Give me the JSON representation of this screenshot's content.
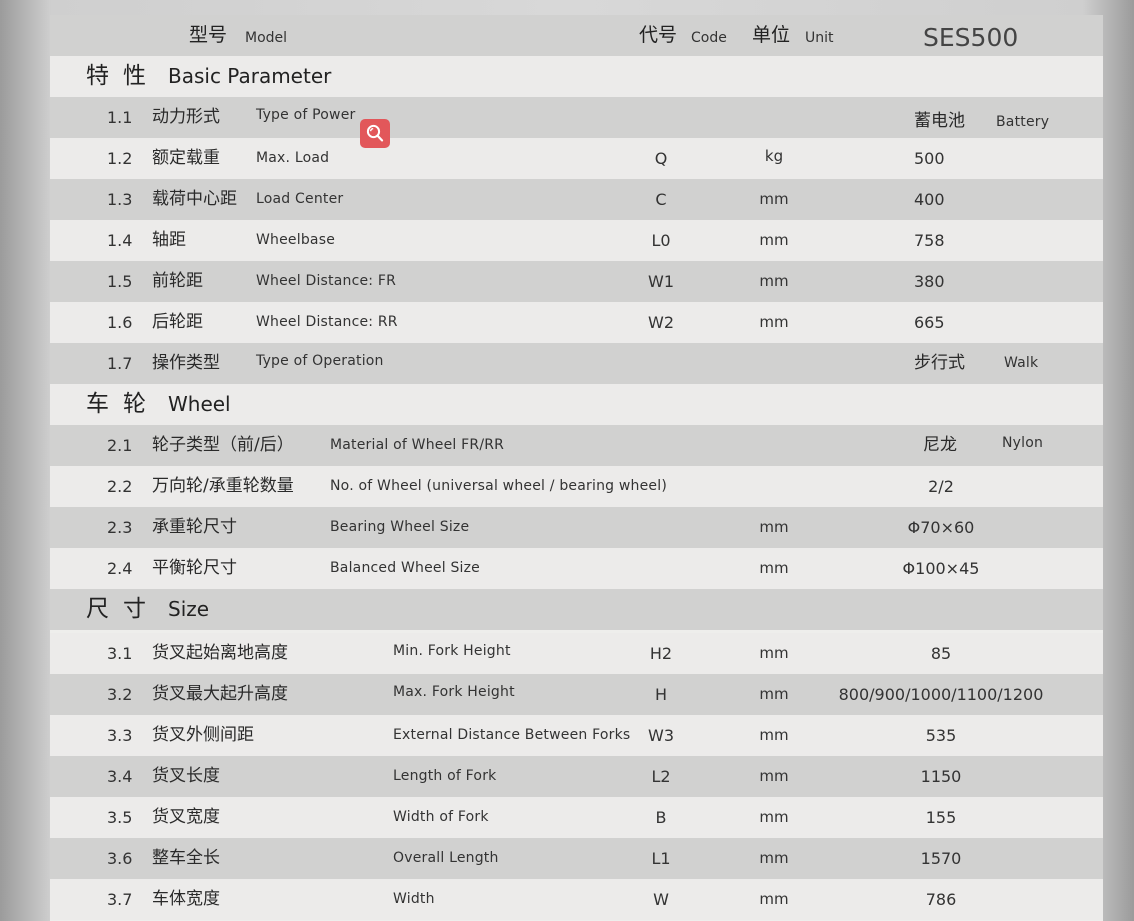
{
  "header": {
    "model_cn": "型号",
    "model_en": "Model",
    "code_cn": "代号",
    "code_en": "Code",
    "unit_cn": "单位",
    "unit_en": "Unit",
    "model_value": "SES500"
  },
  "sections": {
    "basic": {
      "cn": "特性",
      "en": "Basic Parameter"
    },
    "wheel": {
      "cn": "车轮",
      "en": "Wheel"
    },
    "size": {
      "cn": "尺寸",
      "en": "Size"
    }
  },
  "rows": {
    "r1_1": {
      "no": "1.1",
      "cn": "动力形式",
      "en": "Type of Power",
      "code": "",
      "unit": "",
      "value_cn": "蓄电池",
      "value_en": "Battery"
    },
    "r1_2": {
      "no": "1.2",
      "cn": "额定载重",
      "en": "Max. Load",
      "code": "Q",
      "unit": "kg",
      "value": "500"
    },
    "r1_3": {
      "no": "1.3",
      "cn": "载荷中心距",
      "en": "Load Center",
      "code": "C",
      "unit": "mm",
      "value": "400"
    },
    "r1_4": {
      "no": "1.4",
      "cn": "轴距",
      "en": "Wheelbase",
      "code": "L0",
      "unit": "mm",
      "value": "758"
    },
    "r1_5": {
      "no": "1.5",
      "cn": "前轮距",
      "en": "Wheel Distance: FR",
      "code": "W1",
      "unit": "mm",
      "value": "380"
    },
    "r1_6": {
      "no": "1.6",
      "cn": "后轮距",
      "en": "Wheel Distance: RR",
      "code": "W2",
      "unit": "mm",
      "value": "665"
    },
    "r1_7": {
      "no": "1.7",
      "cn": "操作类型",
      "en": "Type of Operation",
      "code": "",
      "unit": "",
      "value_cn": "步行式",
      "value_en": "Walk"
    },
    "r2_1": {
      "no": "2.1",
      "cn": "轮子类型（前/后）",
      "en": "Material of Wheel FR/RR",
      "code": "",
      "unit": "",
      "value_cn": "尼龙",
      "value_en": "Nylon"
    },
    "r2_2": {
      "no": "2.2",
      "cn": "万向轮/承重轮数量",
      "en": "No. of Wheel (universal wheel / bearing wheel)",
      "code": "",
      "unit": "",
      "value": "2/2"
    },
    "r2_3": {
      "no": "2.3",
      "cn": "承重轮尺寸",
      "en": "Bearing Wheel Size",
      "code": "",
      "unit": "mm",
      "value": "Φ70×60"
    },
    "r2_4": {
      "no": "2.4",
      "cn": "平衡轮尺寸",
      "en": "Balanced Wheel Size",
      "code": "",
      "unit": "mm",
      "value": "Φ100×45"
    },
    "r3_1": {
      "no": "3.1",
      "cn": "货叉起始离地高度",
      "en": "Min. Fork Height",
      "code": "H2",
      "unit": "mm",
      "value": "85"
    },
    "r3_2": {
      "no": "3.2",
      "cn": "货叉最大起升高度",
      "en": "Max. Fork Height",
      "code": "H",
      "unit": "mm",
      "value": "800/900/1000/1100/1200"
    },
    "r3_3": {
      "no": "3.3",
      "cn": "货叉外侧间距",
      "en": "External Distance Between Forks",
      "code": "W3",
      "unit": "mm",
      "value": "535"
    },
    "r3_4": {
      "no": "3.4",
      "cn": "货叉长度",
      "en": "Length of Fork",
      "code": "L2",
      "unit": "mm",
      "value": "1150"
    },
    "r3_5": {
      "no": "3.5",
      "cn": "货叉宽度",
      "en": "Width of Fork",
      "code": "B",
      "unit": "mm",
      "value": "155"
    },
    "r3_6": {
      "no": "3.6",
      "cn": "整车全长",
      "en": "Overall Length",
      "code": "L1",
      "unit": "mm",
      "value": "1570"
    },
    "r3_7": {
      "no": "3.7",
      "cn": "车体宽度",
      "en": "Width",
      "code": "W",
      "unit": "mm",
      "value": "786"
    }
  },
  "icons": {
    "search": "search-icon"
  },
  "colors": {
    "search_button": "#e2575a",
    "row_dark": "#d1d1d0",
    "row_light": "#ecebea"
  }
}
